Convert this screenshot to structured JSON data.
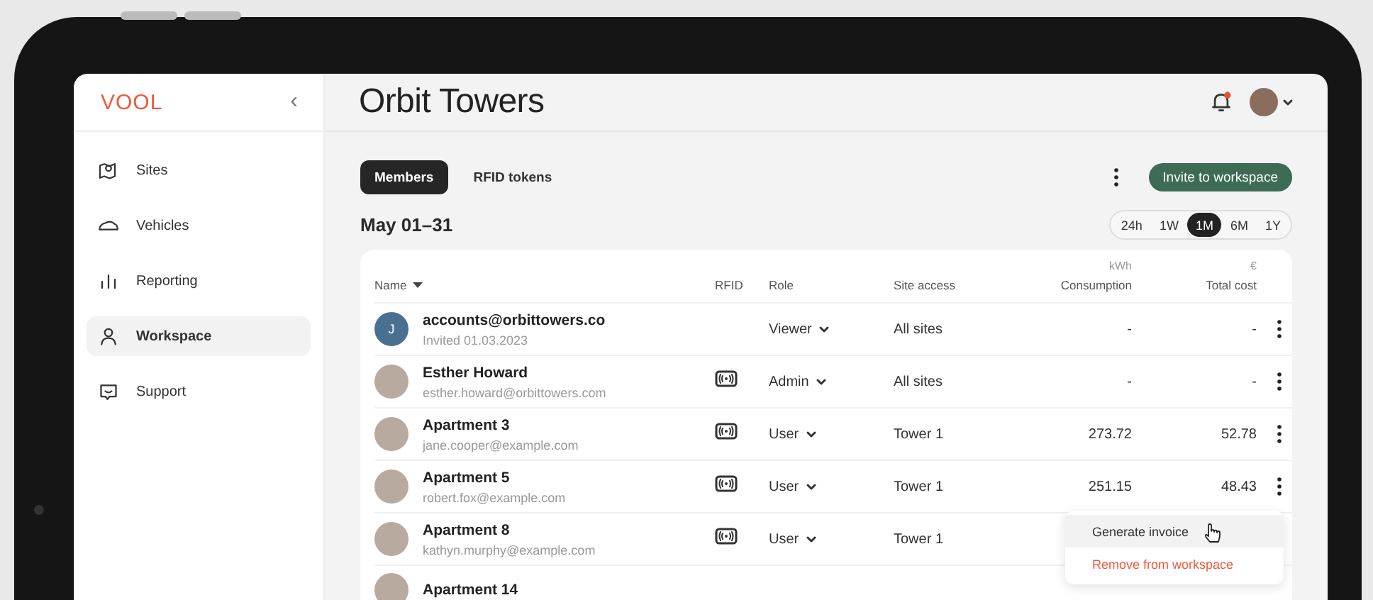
{
  "sidebar": {
    "logo": "VOOL",
    "collapse_icon": "‹",
    "items": [
      {
        "label": "Sites",
        "selected": false
      },
      {
        "label": "Vehicles",
        "selected": false
      },
      {
        "label": "Reporting",
        "selected": false
      },
      {
        "label": "Workspace",
        "selected": true
      },
      {
        "label": "Support",
        "selected": false
      }
    ]
  },
  "header": {
    "title": "Orbit Towers",
    "notifications": {
      "unread": true
    }
  },
  "tabs": [
    {
      "label": "Members",
      "selected": true
    },
    {
      "label": "RFID tokens",
      "selected": false
    }
  ],
  "invite_button": "Invite to workspace",
  "period": "May 01–31",
  "ranges": [
    {
      "label": "24h",
      "selected": false
    },
    {
      "label": "1W",
      "selected": false
    },
    {
      "label": "1M",
      "selected": true
    },
    {
      "label": "6M",
      "selected": false
    },
    {
      "label": "1Y",
      "selected": false
    }
  ],
  "table": {
    "columns": [
      {
        "label": "Name",
        "sortable": true
      },
      {
        "label": "RFID",
        "sortable": false
      },
      {
        "label": "Role",
        "sortable": false
      },
      {
        "label": "Site access",
        "sortable": false
      },
      {
        "label": "Consumption",
        "unit": "kWh",
        "sortable": false
      },
      {
        "label": "Total cost",
        "unit": "€",
        "sortable": false
      }
    ],
    "rows": [
      {
        "avatar": {
          "kind": "initial",
          "initial": "J",
          "color": "#4a7090"
        },
        "name": "accounts@orbittowers.co",
        "subtitle": "Invited 01.03.2023",
        "rfid": false,
        "role": "Viewer",
        "site_access": "All sites",
        "consumption": "-",
        "total_cost": "-"
      },
      {
        "avatar": {
          "kind": "photo"
        },
        "name": "Esther Howard",
        "subtitle": "esther.howard@orbittowers.com",
        "rfid": true,
        "role": "Admin",
        "site_access": "All sites",
        "consumption": "-",
        "total_cost": "-"
      },
      {
        "avatar": {
          "kind": "photo"
        },
        "name": "Apartment 3",
        "subtitle": "jane.cooper@example.com",
        "rfid": true,
        "role": "User",
        "site_access": "Tower 1",
        "consumption": "273.72",
        "total_cost": "52.78"
      },
      {
        "avatar": {
          "kind": "photo"
        },
        "name": "Apartment 5",
        "subtitle": "robert.fox@example.com",
        "rfid": true,
        "role": "User",
        "site_access": "Tower 1",
        "consumption": "251.15",
        "total_cost": "48.43"
      },
      {
        "avatar": {
          "kind": "photo"
        },
        "name": "Apartment 8",
        "subtitle": "kathyn.murphy@example.com",
        "rfid": true,
        "role": "User",
        "site_access": "Tower 1"
      },
      {
        "avatar": {
          "kind": "photo"
        },
        "name": "Apartment 14"
      }
    ]
  },
  "row_menu": {
    "items": [
      {
        "label": "Generate invoice",
        "kind": "normal",
        "highlighted": true
      },
      {
        "label": "Remove from workspace",
        "kind": "danger",
        "highlighted": false
      }
    ]
  }
}
